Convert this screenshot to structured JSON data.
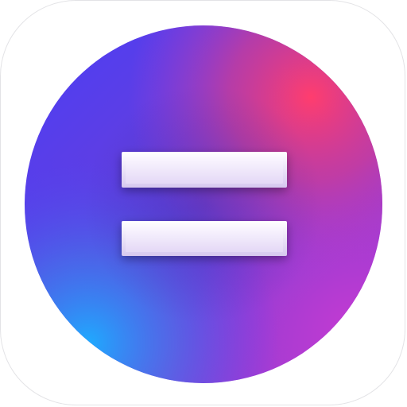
{
  "icon": {
    "name": "equals-icon",
    "colors": {
      "tile_background": "#ffffff",
      "tile_border": "#e3e3e6",
      "gradient_blue": "#4b3cf5",
      "gradient_cyan": "#1fa6ff",
      "gradient_pink": "#ff3d6e",
      "gradient_magenta": "#b63ad0",
      "bar_fill_top": "#f7f3ff",
      "bar_fill_bottom": "#e7dcf7",
      "bar_edge": "#ffffff"
    }
  }
}
